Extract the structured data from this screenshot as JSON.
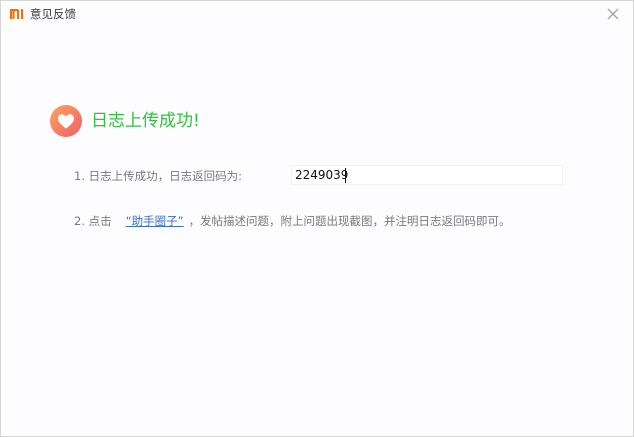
{
  "window": {
    "title": "意见反馈",
    "logo": "mi-logo",
    "close_icon": "close-icon"
  },
  "success": {
    "icon": "heart-icon",
    "message": "日志上传成功!"
  },
  "step1": {
    "label": "1. 日志上传成功，日志返回码为:",
    "code": "2249039"
  },
  "step2": {
    "prefix": "2. 点击",
    "link": "“助手圈子”",
    "suffix": "，发帖描述问题，附上问题出现截图，并注明日志返回码即可。"
  },
  "colors": {
    "brand": "#ff6a00",
    "success_text": "#30c23c",
    "link": "#3a6ec8",
    "icon_gradient_start": "#ff9f5a",
    "icon_gradient_end": "#f0656c"
  }
}
